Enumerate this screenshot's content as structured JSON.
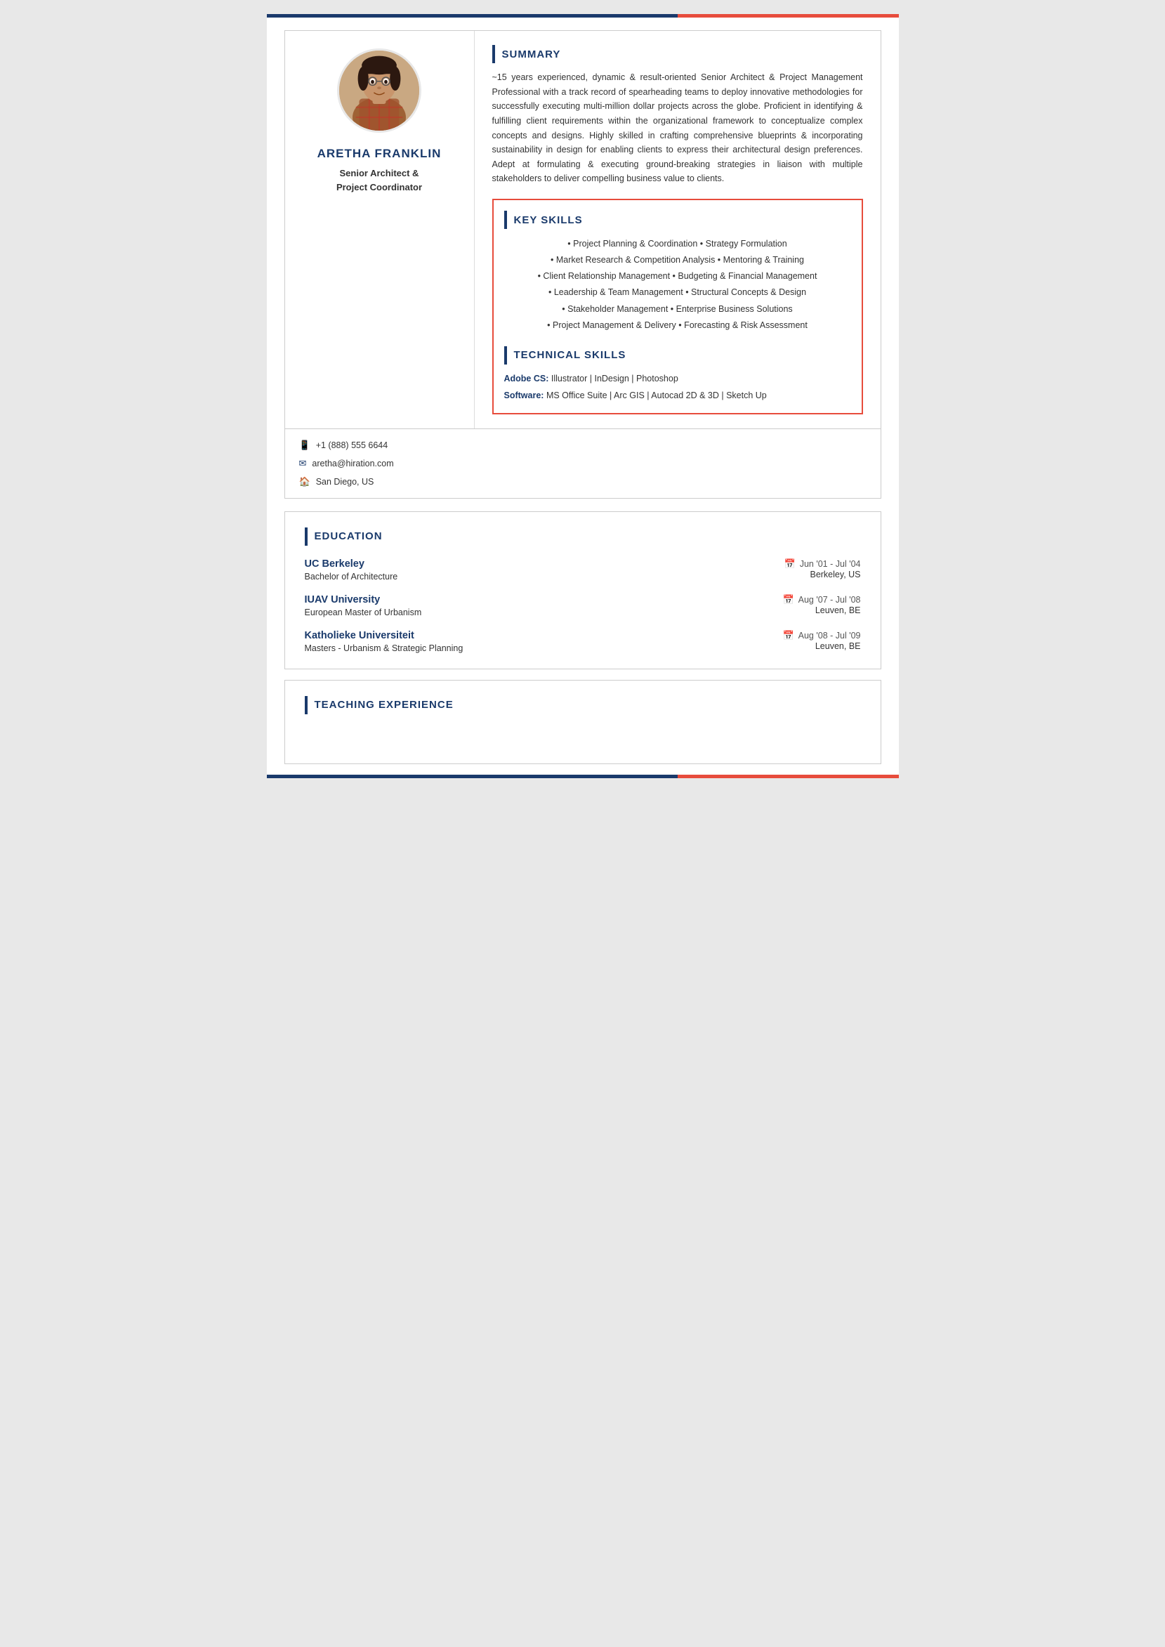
{
  "page": {
    "top_bar_color": "#1a3a6b",
    "accent_color": "#e74c3c"
  },
  "profile": {
    "name": "ARETHA FRANKLiN",
    "title_line1": "Senior Architect &",
    "title_line2": "Project Coordinator",
    "avatar_alt": "Profile photo of Aretha Franklin"
  },
  "contact": {
    "phone": "+1 (888) 555 6644",
    "email": "aretha@hiration.com",
    "location": "San Diego, US"
  },
  "summary": {
    "section_title": "SUMMARY",
    "text": "~15 years experienced, dynamic & result-oriented Senior Architect & Project Management Professional with a track record of spearheading teams to deploy innovative methodologies for successfully executing multi-million dollar projects across the globe. Proficient in identifying & fulfilling client requirements within the organizational framework to conceptualize complex concepts and designs. Highly skilled in crafting comprehensive blueprints & incorporating sustainability in design for enabling clients to express their architectural design preferences. Adept at formulating & executing ground-breaking strategies in liaison with multiple stakeholders to deliver compelling business value to clients."
  },
  "key_skills": {
    "section_title": "KEY SKILLS",
    "items": [
      "• Project Planning & Coordination • Strategy Formulation",
      "• Market Research & Competition Analysis • Mentoring & Training",
      "• Client Relationship Management • Budgeting & Financial Management",
      "• Leadership & Team Management • Structural Concepts & Design",
      "• Stakeholder Management • Enterprise Business Solutions",
      "• Project Management & Delivery • Forecasting & Risk Assessment"
    ]
  },
  "technical_skills": {
    "section_title": "TECHNICAL SKILLS",
    "items": [
      {
        "label": "Adobe CS:",
        "values": "Illustrator | InDesign | Photoshop"
      },
      {
        "label": "Software:",
        "values": "MS Office Suite | Arc GIS | Autocad 2D & 3D | Sketch Up"
      }
    ]
  },
  "education": {
    "section_title": "EDUCATION",
    "items": [
      {
        "institution": "UC Berkeley",
        "date": "Jun '01 - Jul '04",
        "degree": "Bachelor of Architecture",
        "location": "Berkeley, US"
      },
      {
        "institution": "IUAV University",
        "date": "Aug '07 - Jul '08",
        "degree": "European Master of Urbanism",
        "location": "Leuven, BE"
      },
      {
        "institution": "Katholieke Universiteit",
        "date": "Aug '08 - Jul '09",
        "degree": "Masters - Urbanism & Strategic Planning",
        "location": "Leuven, BE"
      }
    ]
  },
  "teaching": {
    "section_title": "TEACHING EXPERIENCE"
  }
}
